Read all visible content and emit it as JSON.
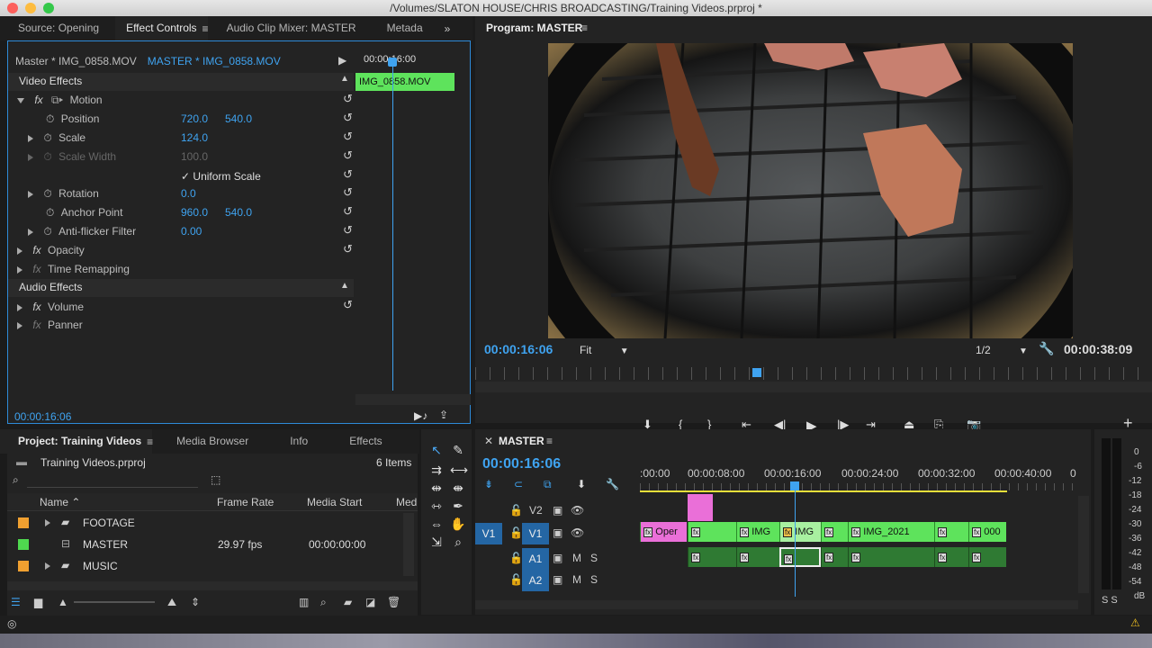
{
  "window": {
    "title": "/Volumes/SLATON HOUSE/CHRIS BROADCASTING/Training Videos.prproj *"
  },
  "effect_panel": {
    "tabs": [
      "Source: Opening",
      "Effect Controls",
      "Audio Clip Mixer: MASTER",
      "Metada"
    ],
    "source_label": "Master * IMG_0858.MOV",
    "seq_label": "MASTER * IMG_0858.MOV",
    "timecode_ruler": "00:00:16:00",
    "clip_name": "IMG_0858.MOV",
    "video_effects": "Video Effects",
    "motion": "Motion",
    "position": {
      "label": "Position",
      "x": "720.0",
      "y": "540.0"
    },
    "scale": {
      "label": "Scale",
      "v": "124.0"
    },
    "scale_width": {
      "label": "Scale Width",
      "v": "100.0"
    },
    "uniform": "Uniform Scale",
    "rotation": {
      "label": "Rotation",
      "v": "0.0"
    },
    "anchor": {
      "label": "Anchor Point",
      "x": "960.0",
      "y": "540.0"
    },
    "antiflicker": {
      "label": "Anti-flicker Filter",
      "v": "0.00"
    },
    "opacity": "Opacity",
    "time_remap": "Time Remapping",
    "audio_effects": "Audio Effects",
    "volume": "Volume",
    "panner": "Panner",
    "current_time": "00:00:16:06"
  },
  "program": {
    "title": "Program: MASTER",
    "time": "00:00:16:06",
    "fit": "Fit",
    "res": "1/2",
    "duration": "00:00:38:09"
  },
  "project": {
    "tabs": [
      "Project: Training Videos",
      "Media Browser",
      "Info",
      "Effects"
    ],
    "file": "Training Videos.prproj",
    "count": "6 Items",
    "columns": {
      "name": "Name",
      "frame_rate": "Frame Rate",
      "media_start": "Media Start",
      "media_end": "Med"
    },
    "items": [
      {
        "name": "FOOTAGE",
        "color": "#f0a030",
        "rate": "",
        "start": ""
      },
      {
        "name": "MASTER",
        "color": "#4fd84f",
        "rate": "29.97 fps",
        "start": "00:00:00:00"
      },
      {
        "name": "MUSIC",
        "color": "#f0a030",
        "rate": "",
        "start": ""
      }
    ]
  },
  "timeline": {
    "title": "MASTER",
    "time": "00:00:16:06",
    "ruler": [
      ":00:00",
      "00:00:08:00",
      "00:00:16:00",
      "00:00:24:00",
      "00:00:32:00",
      "00:00:40:00",
      "0"
    ],
    "tracks": {
      "v2": "V2",
      "v1": "V1",
      "a1": "A1",
      "a2": "A2",
      "src_v1": "V1",
      "m": "M",
      "s": "S"
    },
    "clips": {
      "open": "Oper",
      "img1": "IMG",
      "img2": "IMG",
      "img3": "IMG_2021",
      "img4": "000"
    }
  },
  "meter": {
    "scale": [
      "0",
      "-6",
      "-12",
      "-18",
      "-24",
      "-30",
      "-36",
      "-42",
      "-48",
      "-54",
      "dB"
    ],
    "solo": "S S"
  }
}
